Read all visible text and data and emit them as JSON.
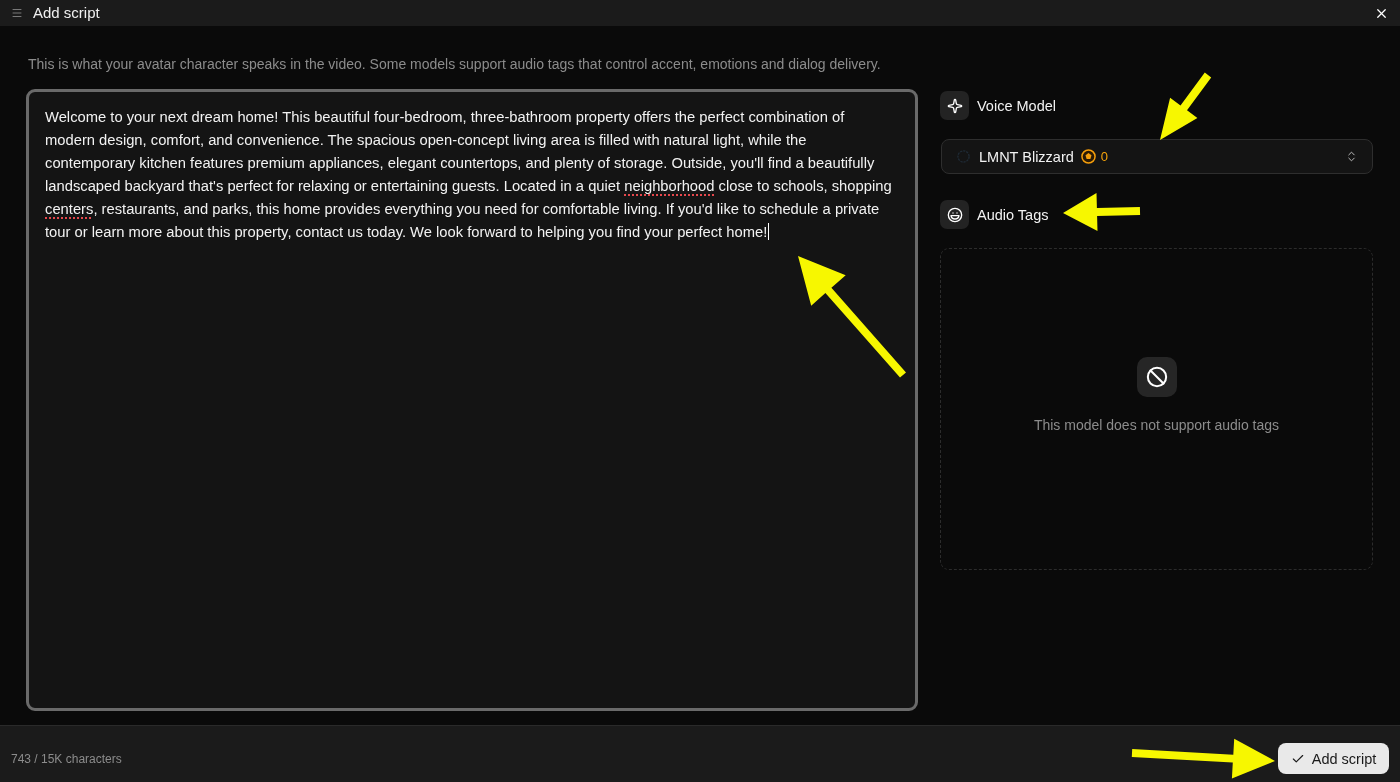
{
  "window": {
    "title": "Add script"
  },
  "description": "This is what your avatar character speaks in the video. Some models support audio tags that control accent, emotions and dialog delivery.",
  "script_editor": {
    "focused": true,
    "segments": [
      {
        "text": "Welcome to your next dream home! This beautiful four-bedroom, three-bathroom property offers the perfect combination of modern design, comfort, and convenience. The spacious open-concept living area is filled with natural light, while the contemporary kitchen features premium appliances, elegant countertops, and plenty of storage. Outside, you'll find a beautifully landscaped backyard that's perfect for relaxing or entertaining guests. Located in a quiet ",
        "misspelled": false
      },
      {
        "text": "neighborhood",
        "misspelled": true
      },
      {
        "text": " close to schools, shopping ",
        "misspelled": false
      },
      {
        "text": "centers",
        "misspelled": true
      },
      {
        "text": ", restaurants, and parks, this home provides everything you need for comfortable living. If you'd like to schedule a private tour or learn more about this property, contact us today. We look forward to helping you find your perfect home!",
        "misspelled": false
      }
    ]
  },
  "voice_model": {
    "label": "Voice Model",
    "select": {
      "value": "LMNT Blizzard",
      "cost": "0"
    }
  },
  "audio_tags": {
    "label": "Audio Tags",
    "empty_message": "This model does not support audio tags"
  },
  "footer": {
    "character_count": "743 / 15K characters",
    "submit_button": "Add script"
  }
}
